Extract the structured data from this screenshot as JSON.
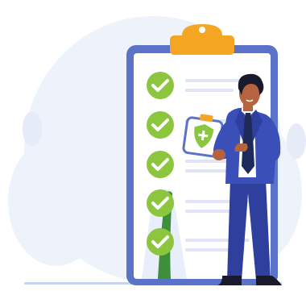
{
  "illustration": {
    "subject": "checklist-clipboard-with-businessman",
    "icons": [
      "clipboard-icon",
      "check-icon",
      "shield-plus-icon"
    ],
    "checklist": {
      "items": [
        {
          "checked": true
        },
        {
          "checked": true
        },
        {
          "checked": true
        },
        {
          "checked": true
        },
        {
          "checked": true
        }
      ]
    },
    "colors": {
      "background_blob": "#eef2fb",
      "clipboard_frame": "#5a73c9",
      "paper": "#ffffff",
      "clip": "#f4a623",
      "check": "#8cc63f",
      "suit": "#2f3f9e",
      "shirt": "#ffffff",
      "tie": "#1e2a5a",
      "skin": "#b5643f",
      "hair": "#1a1a2e"
    }
  }
}
